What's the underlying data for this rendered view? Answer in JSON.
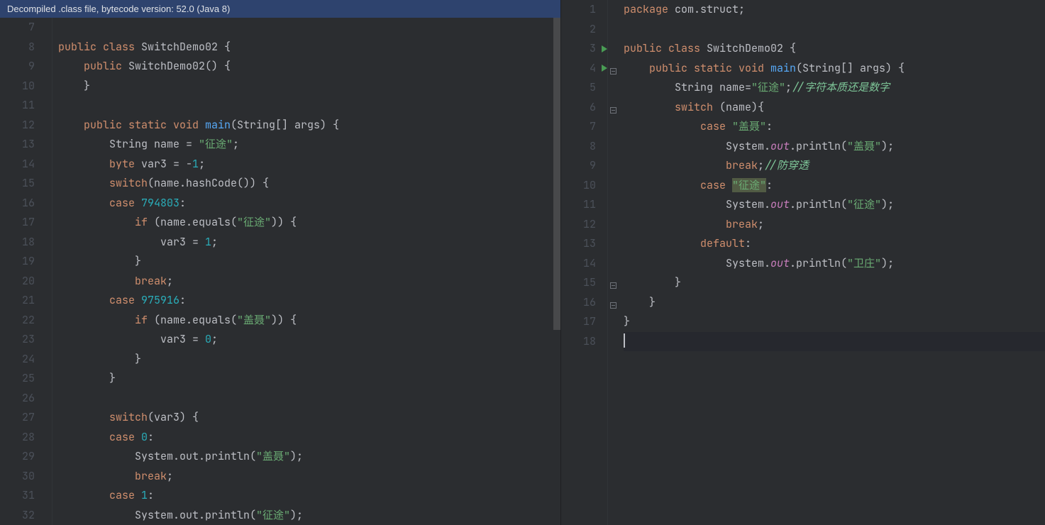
{
  "banner": {
    "text": "Decompiled .class file, bytecode version: 52.0 (Java 8)"
  },
  "left": {
    "startLine": 7,
    "lines": [
      {
        "n": 7,
        "tokens": []
      },
      {
        "n": 8,
        "tokens": [
          {
            "t": "public ",
            "c": "kw"
          },
          {
            "t": "class ",
            "c": "kw"
          },
          {
            "t": "SwitchDemo02 {",
            "c": "txt"
          }
        ]
      },
      {
        "n": 9,
        "tokens": [
          {
            "t": "    ",
            "c": "txt"
          },
          {
            "t": "public ",
            "c": "kw"
          },
          {
            "t": "SwitchDemo02",
            "c": "txt"
          },
          {
            "t": "() {",
            "c": "txt"
          }
        ]
      },
      {
        "n": 10,
        "tokens": [
          {
            "t": "    }",
            "c": "txt"
          }
        ]
      },
      {
        "n": 11,
        "tokens": []
      },
      {
        "n": 12,
        "tokens": [
          {
            "t": "    ",
            "c": "txt"
          },
          {
            "t": "public static void ",
            "c": "kw"
          },
          {
            "t": "main",
            "c": "fn"
          },
          {
            "t": "(String[] args) {",
            "c": "txt"
          }
        ]
      },
      {
        "n": 13,
        "tokens": [
          {
            "t": "        String name = ",
            "c": "txt"
          },
          {
            "t": "\"征途\"",
            "c": "str"
          },
          {
            "t": ";",
            "c": "txt"
          }
        ]
      },
      {
        "n": 14,
        "tokens": [
          {
            "t": "        ",
            "c": "txt"
          },
          {
            "t": "byte ",
            "c": "kw"
          },
          {
            "t": "var3 = -",
            "c": "txt"
          },
          {
            "t": "1",
            "c": "num"
          },
          {
            "t": ";",
            "c": "txt"
          }
        ]
      },
      {
        "n": 15,
        "tokens": [
          {
            "t": "        ",
            "c": "txt"
          },
          {
            "t": "switch",
            "c": "kw"
          },
          {
            "t": "(name.hashCode()) {",
            "c": "txt"
          }
        ]
      },
      {
        "n": 16,
        "tokens": [
          {
            "t": "        ",
            "c": "txt"
          },
          {
            "t": "case ",
            "c": "kw"
          },
          {
            "t": "794803",
            "c": "num"
          },
          {
            "t": ":",
            "c": "txt"
          }
        ]
      },
      {
        "n": 17,
        "tokens": [
          {
            "t": "            ",
            "c": "txt"
          },
          {
            "t": "if ",
            "c": "kw"
          },
          {
            "t": "(name.equals(",
            "c": "txt"
          },
          {
            "t": "\"征途\"",
            "c": "str"
          },
          {
            "t": ")) {",
            "c": "txt"
          }
        ]
      },
      {
        "n": 18,
        "tokens": [
          {
            "t": "                var3 = ",
            "c": "txt"
          },
          {
            "t": "1",
            "c": "num"
          },
          {
            "t": ";",
            "c": "txt"
          }
        ]
      },
      {
        "n": 19,
        "tokens": [
          {
            "t": "            }",
            "c": "txt"
          }
        ]
      },
      {
        "n": 20,
        "tokens": [
          {
            "t": "            ",
            "c": "txt"
          },
          {
            "t": "break",
            "c": "kw"
          },
          {
            "t": ";",
            "c": "txt"
          }
        ]
      },
      {
        "n": 21,
        "tokens": [
          {
            "t": "        ",
            "c": "txt"
          },
          {
            "t": "case ",
            "c": "kw"
          },
          {
            "t": "975916",
            "c": "num"
          },
          {
            "t": ":",
            "c": "txt"
          }
        ]
      },
      {
        "n": 22,
        "tokens": [
          {
            "t": "            ",
            "c": "txt"
          },
          {
            "t": "if ",
            "c": "kw"
          },
          {
            "t": "(name.equals(",
            "c": "txt"
          },
          {
            "t": "\"盖聂\"",
            "c": "str"
          },
          {
            "t": ")) {",
            "c": "txt"
          }
        ]
      },
      {
        "n": 23,
        "tokens": [
          {
            "t": "                var3 = ",
            "c": "txt"
          },
          {
            "t": "0",
            "c": "num"
          },
          {
            "t": ";",
            "c": "txt"
          }
        ]
      },
      {
        "n": 24,
        "tokens": [
          {
            "t": "            }",
            "c": "txt"
          }
        ]
      },
      {
        "n": 25,
        "tokens": [
          {
            "t": "        }",
            "c": "txt"
          }
        ]
      },
      {
        "n": 26,
        "tokens": []
      },
      {
        "n": 27,
        "tokens": [
          {
            "t": "        ",
            "c": "txt"
          },
          {
            "t": "switch",
            "c": "kw"
          },
          {
            "t": "(var3) {",
            "c": "txt"
          }
        ]
      },
      {
        "n": 28,
        "tokens": [
          {
            "t": "        ",
            "c": "txt"
          },
          {
            "t": "case ",
            "c": "kw"
          },
          {
            "t": "0",
            "c": "num"
          },
          {
            "t": ":",
            "c": "txt"
          }
        ]
      },
      {
        "n": 29,
        "tokens": [
          {
            "t": "            System.out.println(",
            "c": "txt"
          },
          {
            "t": "\"盖聂\"",
            "c": "str"
          },
          {
            "t": ");",
            "c": "txt"
          }
        ]
      },
      {
        "n": 30,
        "tokens": [
          {
            "t": "            ",
            "c": "txt"
          },
          {
            "t": "break",
            "c": "kw"
          },
          {
            "t": ";",
            "c": "txt"
          }
        ]
      },
      {
        "n": 31,
        "tokens": [
          {
            "t": "        ",
            "c": "txt"
          },
          {
            "t": "case ",
            "c": "kw"
          },
          {
            "t": "1",
            "c": "num"
          },
          {
            "t": ":",
            "c": "txt"
          }
        ]
      },
      {
        "n": 32,
        "tokens": [
          {
            "t": "            System.out.println(",
            "c": "txt"
          },
          {
            "t": "\"征途\"",
            "c": "str"
          },
          {
            "t": ");",
            "c": "txt"
          }
        ]
      }
    ]
  },
  "right": {
    "lines": [
      {
        "n": 1,
        "tokens": [
          {
            "t": "package ",
            "c": "kw"
          },
          {
            "t": "com.struct;",
            "c": "pk"
          }
        ]
      },
      {
        "n": 2,
        "tokens": []
      },
      {
        "n": 3,
        "run": true,
        "tokens": [
          {
            "t": "public class ",
            "c": "kw"
          },
          {
            "t": "SwitchDemo02 {",
            "c": "txt"
          }
        ]
      },
      {
        "n": 4,
        "run": true,
        "fold": true,
        "tokens": [
          {
            "t": "    ",
            "c": "txt"
          },
          {
            "t": "public static void ",
            "c": "kw"
          },
          {
            "t": "main",
            "c": "fn"
          },
          {
            "t": "(String[] args) {",
            "c": "txt"
          }
        ]
      },
      {
        "n": 5,
        "tokens": [
          {
            "t": "        String name=",
            "c": "txt"
          },
          {
            "t": "\"征途\"",
            "c": "str"
          },
          {
            "t": ";",
            "c": "txt"
          },
          {
            "t": "//字符本质还是数字",
            "c": "cmt"
          }
        ]
      },
      {
        "n": 6,
        "fold": true,
        "tokens": [
          {
            "t": "        ",
            "c": "txt"
          },
          {
            "t": "switch ",
            "c": "kw"
          },
          {
            "t": "(name){",
            "c": "txt"
          }
        ]
      },
      {
        "n": 7,
        "tokens": [
          {
            "t": "            ",
            "c": "txt"
          },
          {
            "t": "case ",
            "c": "kw"
          },
          {
            "t": "\"盖聂\"",
            "c": "str"
          },
          {
            "t": ":",
            "c": "txt"
          }
        ]
      },
      {
        "n": 8,
        "tokens": [
          {
            "t": "                System.",
            "c": "txt"
          },
          {
            "t": "out",
            "c": "field"
          },
          {
            "t": ".println(",
            "c": "txt"
          },
          {
            "t": "\"盖聂\"",
            "c": "str"
          },
          {
            "t": ");",
            "c": "txt"
          }
        ]
      },
      {
        "n": 9,
        "tokens": [
          {
            "t": "                ",
            "c": "txt"
          },
          {
            "t": "break",
            "c": "kw"
          },
          {
            "t": ";",
            "c": "txt"
          },
          {
            "t": "//防穿透",
            "c": "cmt"
          }
        ]
      },
      {
        "n": 10,
        "tokens": [
          {
            "t": "            ",
            "c": "txt"
          },
          {
            "t": "case ",
            "c": "kw"
          },
          {
            "t": "\"征途\"",
            "c": "str hl"
          },
          {
            "t": ":",
            "c": "txt"
          }
        ]
      },
      {
        "n": 11,
        "tokens": [
          {
            "t": "                System.",
            "c": "txt"
          },
          {
            "t": "out",
            "c": "field"
          },
          {
            "t": ".println(",
            "c": "txt"
          },
          {
            "t": "\"征途\"",
            "c": "str"
          },
          {
            "t": ");",
            "c": "txt"
          }
        ]
      },
      {
        "n": 12,
        "tokens": [
          {
            "t": "                ",
            "c": "txt"
          },
          {
            "t": "break",
            "c": "kw"
          },
          {
            "t": ";",
            "c": "txt"
          }
        ]
      },
      {
        "n": 13,
        "tokens": [
          {
            "t": "            ",
            "c": "txt"
          },
          {
            "t": "default",
            "c": "kw"
          },
          {
            "t": ":",
            "c": "txt"
          }
        ]
      },
      {
        "n": 14,
        "tokens": [
          {
            "t": "                System.",
            "c": "txt"
          },
          {
            "t": "out",
            "c": "field"
          },
          {
            "t": ".println(",
            "c": "txt"
          },
          {
            "t": "\"卫庄\"",
            "c": "str"
          },
          {
            "t": ");",
            "c": "txt"
          }
        ]
      },
      {
        "n": 15,
        "foldEnd": true,
        "tokens": [
          {
            "t": "        }",
            "c": "txt"
          }
        ]
      },
      {
        "n": 16,
        "foldEnd": true,
        "tokens": [
          {
            "t": "    }",
            "c": "txt"
          }
        ]
      },
      {
        "n": 17,
        "tokens": [
          {
            "t": "}",
            "c": "txt"
          }
        ]
      },
      {
        "n": 18,
        "cursor": true,
        "tokens": []
      }
    ]
  }
}
